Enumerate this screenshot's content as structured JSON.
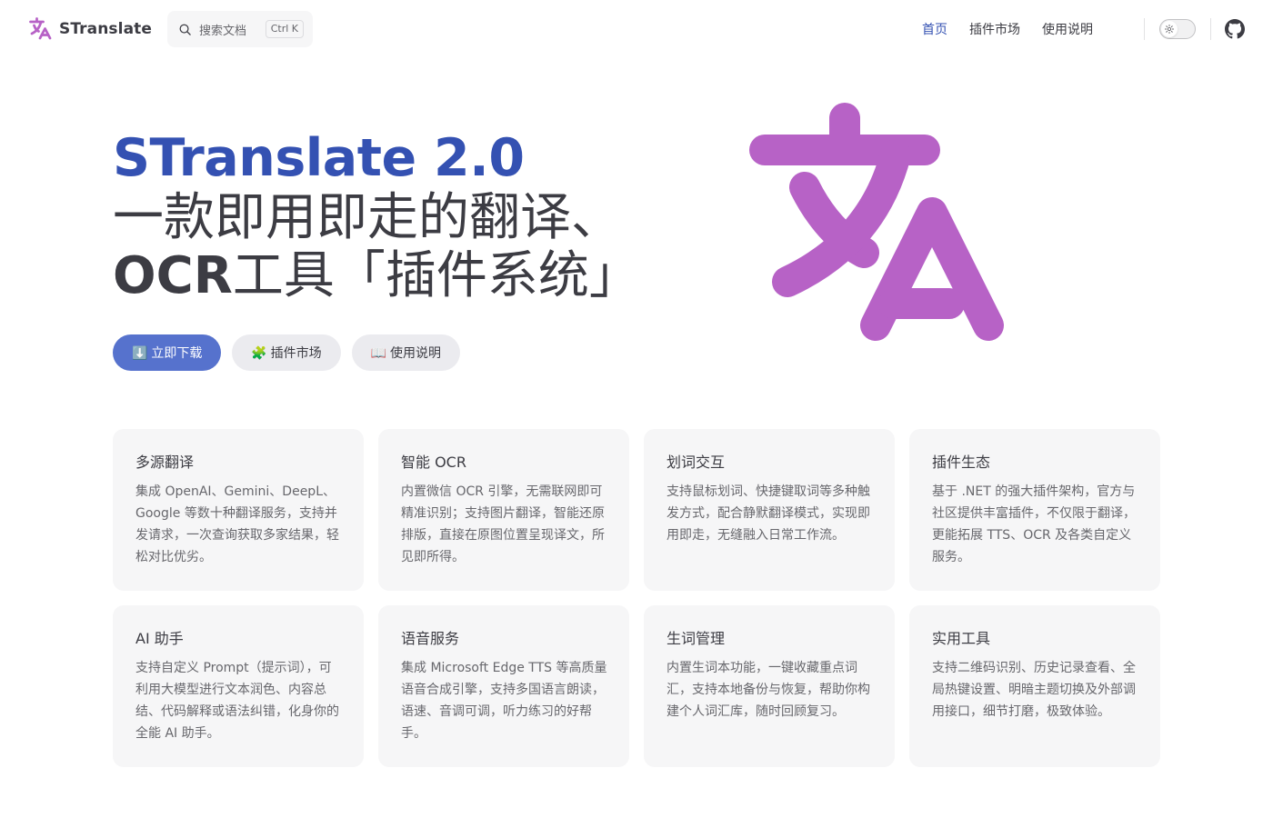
{
  "nav": {
    "brand": "STranslate",
    "search": {
      "placeholder": "搜索文档",
      "shortcut": "Ctrl K"
    },
    "links": [
      {
        "label": "首页",
        "active": true
      },
      {
        "label": "插件市场",
        "active": false
      },
      {
        "label": "使用说明",
        "active": false
      }
    ],
    "icons": [
      "translate-icon",
      "search-icon",
      "sun-icon",
      "github-icon"
    ]
  },
  "hero": {
    "name": "STranslate 2.0",
    "line1": "一款即用即走的翻译、",
    "line2_bold": "OCR",
    "line2_rest": "工具「插件系统」",
    "actions": [
      {
        "label": "⬇️ 立即下载",
        "theme": "brand"
      },
      {
        "label": "🧩 插件市场",
        "theme": "alt"
      },
      {
        "label": "📖 使用说明",
        "theme": "alt"
      }
    ]
  },
  "features": [
    {
      "title": "多源翻译",
      "desc": "集成 OpenAI、Gemini、DeepL、Google 等数十种翻译服务，支持并发请求，一次查询获取多家结果，轻松对比优劣。"
    },
    {
      "title": "智能 OCR",
      "desc": "内置微信 OCR 引擎，无需联网即可精准识别；支持图片翻译，智能还原排版，直接在原图位置呈现译文，所见即所得。"
    },
    {
      "title": "划词交互",
      "desc": "支持鼠标划词、快捷键取词等多种触发方式，配合静默翻译模式，实现即用即走，无缝融入日常工作流。"
    },
    {
      "title": "插件生态",
      "desc": "基于 .NET 的强大插件架构，官方与社区提供丰富插件，不仅限于翻译，更能拓展 TTS、OCR 及各类自定义服务。"
    },
    {
      "title": "AI 助手",
      "desc": "支持自定义 Prompt（提示词），可利用大模型进行文本润色、内容总结、代码解释或语法纠错，化身你的全能 AI 助手。"
    },
    {
      "title": "语音服务",
      "desc": "集成 Microsoft Edge TTS 等高质量语音合成引擎，支持多国语言朗读，语速、音调可调，听力练习的好帮手。"
    },
    {
      "title": "生词管理",
      "desc": "内置生词本功能，一键收藏重点词汇，支持本地备份与恢复，帮助你构建个人词汇库，随时回顾复习。"
    },
    {
      "title": "实用工具",
      "desc": "支持二维码识别、历史记录查看、全局热键设置、明暗主题切换及外部调用接口，细节打磨，极致体验。"
    }
  ],
  "colors": {
    "brand": "#3451b2",
    "logo": "#b762c6",
    "button": "#5672cd"
  }
}
